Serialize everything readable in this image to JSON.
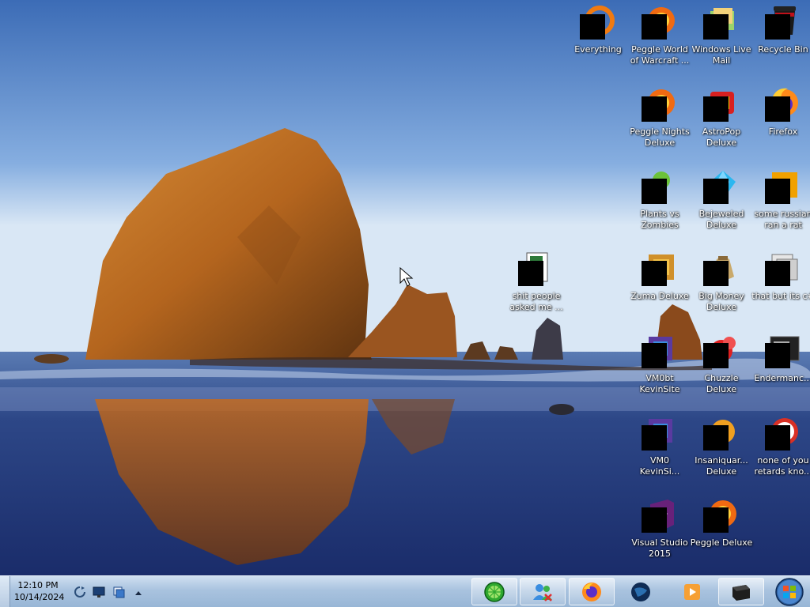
{
  "desktop_icons": [
    {
      "key": "recycle-bin",
      "label": "Recycle Bin",
      "icon": "recycle-bin-icon"
    },
    {
      "key": "windows-live-mail",
      "label": "Windows Live\nMail",
      "icon": "mail-icon"
    },
    {
      "key": "peggle-world-of-warcraft",
      "label": "Peggle World\nof Warcraft ...",
      "icon": "peggle-icon"
    },
    {
      "key": "everything",
      "label": "Everything",
      "icon": "search-ring-icon"
    },
    {
      "key": "firefox",
      "label": "Firefox",
      "icon": "firefox-icon"
    },
    {
      "key": "astropop-deluxe",
      "label": "AstroPop\nDeluxe",
      "icon": "astropop-icon"
    },
    {
      "key": "peggle-nights-deluxe",
      "label": "Peggle Nights\nDeluxe",
      "icon": "peggle-icon"
    },
    {
      "key": "some-russian",
      "label": "some russian\nran a rat",
      "icon": "app-icon"
    },
    {
      "key": "bejeweled-deluxe",
      "label": "Bejeweled\nDeluxe",
      "icon": "gem-icon"
    },
    {
      "key": "plants-vs-zombies",
      "label": "Plants vs\nZombies",
      "icon": "plant-icon"
    },
    {
      "key": "that-but-its-c",
      "label": "that but its c#",
      "icon": "folder-icon"
    },
    {
      "key": "big-money-deluxe",
      "label": "Big Money\nDeluxe",
      "icon": "money-bag-icon"
    },
    {
      "key": "zuma-deluxe",
      "label": "Zuma Deluxe",
      "icon": "zuma-icon"
    },
    {
      "key": "shit-people",
      "label": "shit people\nasked me ...",
      "icon": "text-file-icon"
    },
    {
      "key": "endermanch",
      "label": "Endermanc...",
      "icon": "terminal-icon"
    },
    {
      "key": "chuzzle-deluxe",
      "label": "Chuzzle\nDeluxe",
      "icon": "chuzzle-icon"
    },
    {
      "key": "vm0bt",
      "label": "VM0bt\nKevinSite",
      "icon": "vm-icon"
    },
    {
      "key": "none-of-you",
      "label": "none of you\nretards kno...",
      "icon": "chrome-icon"
    },
    {
      "key": "insaniquarium",
      "label": "Insaniquar...\nDeluxe",
      "icon": "fish-icon"
    },
    {
      "key": "vm0-kevinsi",
      "label": "VM0\nKevinSi...",
      "icon": "vm-icon"
    },
    {
      "key": "peggle-deluxe",
      "label": "Peggle Deluxe",
      "icon": "peggle-icon"
    },
    {
      "key": "visual-studio-2015",
      "label": "Visual Studio\n2015",
      "icon": "visual-studio-icon"
    }
  ],
  "taskbar": {
    "start_button": "windows-orb-icon",
    "pinned": [
      {
        "key": "terminal",
        "icon": "terminal-icon"
      },
      {
        "key": "media-player",
        "icon": "media-player-icon"
      },
      {
        "key": "globe",
        "icon": "globe-icon"
      },
      {
        "key": "firefox",
        "icon": "firefox-icon"
      },
      {
        "key": "users",
        "icon": "users-icon"
      },
      {
        "key": "lime",
        "icon": "lime-icon"
      }
    ],
    "tray_icons": [
      "network-icon",
      "monitor-icon",
      "refresh-icon",
      "chevron-up-icon"
    ],
    "clock": {
      "time": "12:10 PM",
      "date": "10/14/2024"
    }
  },
  "colors": {
    "taskbar": "#a9c3df",
    "sky_top": "#3f6fb8",
    "sea": "#2a3d7a"
  }
}
